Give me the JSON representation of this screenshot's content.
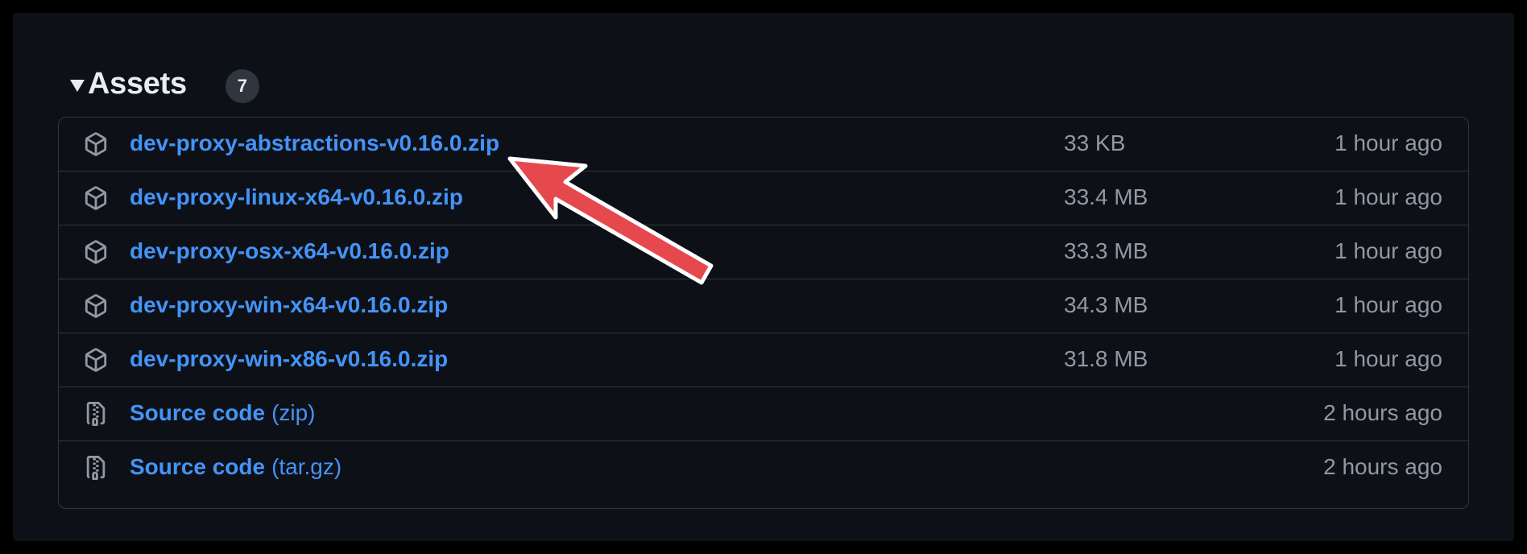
{
  "assets": {
    "title": "Assets",
    "count": "7",
    "rows": [
      {
        "name": "dev-proxy-abstractions-v0.16.0.zip",
        "suffix": "",
        "size": "33 KB",
        "time": "1 hour ago",
        "icon": "package-icon"
      },
      {
        "name": "dev-proxy-linux-x64-v0.16.0.zip",
        "suffix": "",
        "size": "33.4 MB",
        "time": "1 hour ago",
        "icon": "package-icon"
      },
      {
        "name": "dev-proxy-osx-x64-v0.16.0.zip",
        "suffix": "",
        "size": "33.3 MB",
        "time": "1 hour ago",
        "icon": "package-icon"
      },
      {
        "name": "dev-proxy-win-x64-v0.16.0.zip",
        "suffix": "",
        "size": "34.3 MB",
        "time": "1 hour ago",
        "icon": "package-icon"
      },
      {
        "name": "dev-proxy-win-x86-v0.16.0.zip",
        "suffix": "",
        "size": "31.8 MB",
        "time": "1 hour ago",
        "icon": "package-icon"
      },
      {
        "name": "Source code",
        "suffix": "(zip)",
        "size": "",
        "time": "2 hours ago",
        "icon": "file-zip-icon"
      },
      {
        "name": "Source code",
        "suffix": "(tar.gz)",
        "size": "",
        "time": "2 hours ago",
        "icon": "file-zip-icon"
      }
    ]
  },
  "colors": {
    "background": "#0d1117",
    "link": "#4493f8",
    "muted": "#9198a1",
    "border": "#30363d",
    "annotation_arrow": "#e5484d"
  }
}
